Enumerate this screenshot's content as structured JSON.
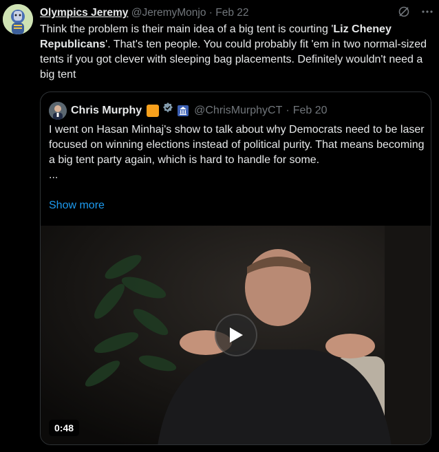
{
  "tweet": {
    "author_name": "Olympics Jeremy",
    "author_handle": "@JeremyMonjo",
    "separator": "·",
    "date": "Feb 22",
    "text_part1": "Think the problem is their main idea of a big tent is courting '",
    "text_bold": "Liz Cheney Republicans",
    "text_part2": "'. That's ten people. You could probably fit 'em in two normal-sized tents if you got clever with sleeping bag placements. Definitely wouldn't need a big tent",
    "grok_icon": "grok-icon",
    "more_icon": "more-icon"
  },
  "quote": {
    "author_name": "Chris Murphy",
    "author_handle": "@ChrisMurphyCT",
    "separator": "·",
    "date": "Feb 20",
    "text_line1": "I went on Hasan Minhaj's show to talk about why Democrats need to be laser focused on winning elections instead of political purity. That means becoming a big tent party again, which is hard to handle for some.",
    "ellipsis": "...",
    "show_more": "Show more",
    "video_duration": "0:48",
    "badges": [
      "orange-affiliate-badge",
      "verified-badge",
      "government-badge"
    ]
  },
  "colors": {
    "background": "#000000",
    "text": "#e7e9ea",
    "muted": "#71767b",
    "link": "#1d9bf0",
    "border": "#2f3336"
  }
}
